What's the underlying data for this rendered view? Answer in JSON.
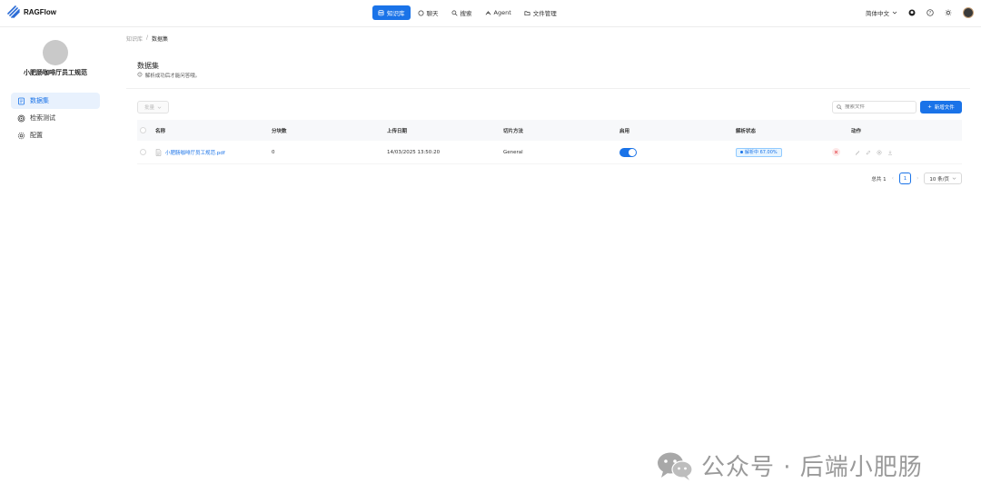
{
  "app": {
    "name": "RAGFlow"
  },
  "nav": {
    "items": [
      {
        "label": "知识库",
        "icon": "database-icon",
        "active": true
      },
      {
        "label": "聊天",
        "icon": "chat-icon",
        "active": false
      },
      {
        "label": "搜索",
        "icon": "search-icon",
        "active": false
      },
      {
        "label": "Agent",
        "icon": "agent-icon",
        "active": false
      },
      {
        "label": "文件管理",
        "icon": "folder-icon",
        "active": false
      }
    ]
  },
  "topbar": {
    "language": "简体中文"
  },
  "sidebar": {
    "kb_name": "小肥肠咖啡厅员工规范",
    "items": [
      {
        "label": "数据集",
        "icon": "dataset-icon",
        "active": true
      },
      {
        "label": "检索测试",
        "icon": "retrieval-icon",
        "active": false
      },
      {
        "label": "配置",
        "icon": "gear-icon",
        "active": false
      }
    ]
  },
  "breadcrumb": {
    "root": "知识库",
    "separator": "/",
    "current": "数据集"
  },
  "page": {
    "title": "数据集",
    "subtitle": "解析成功后才能问答哦。"
  },
  "toolbar": {
    "bulk_label": "批量",
    "search_placeholder": "搜索文件",
    "add_label": "新增文件"
  },
  "table": {
    "headers": {
      "name": "名称",
      "chunks": "分块数",
      "upload_date": "上传日期",
      "chunk_method": "切片方法",
      "enabled": "启用",
      "parse_status": "解析状态",
      "actions": "动作"
    },
    "rows": [
      {
        "name": "小肥肠咖啡厅员工规范.pdf",
        "chunks": "0",
        "upload_date": "14/03/2025 13:50:20",
        "chunk_method": "General",
        "enabled": true,
        "parse_status": "解析中 67.00%"
      }
    ]
  },
  "pagination": {
    "total": "总共 1",
    "current_page": "1",
    "page_size": "10 条/页"
  },
  "watermark": {
    "text": "公众号 · 后端小肥肠"
  },
  "colors": {
    "primary": "#1a73e8",
    "danger": "#e5484d"
  }
}
